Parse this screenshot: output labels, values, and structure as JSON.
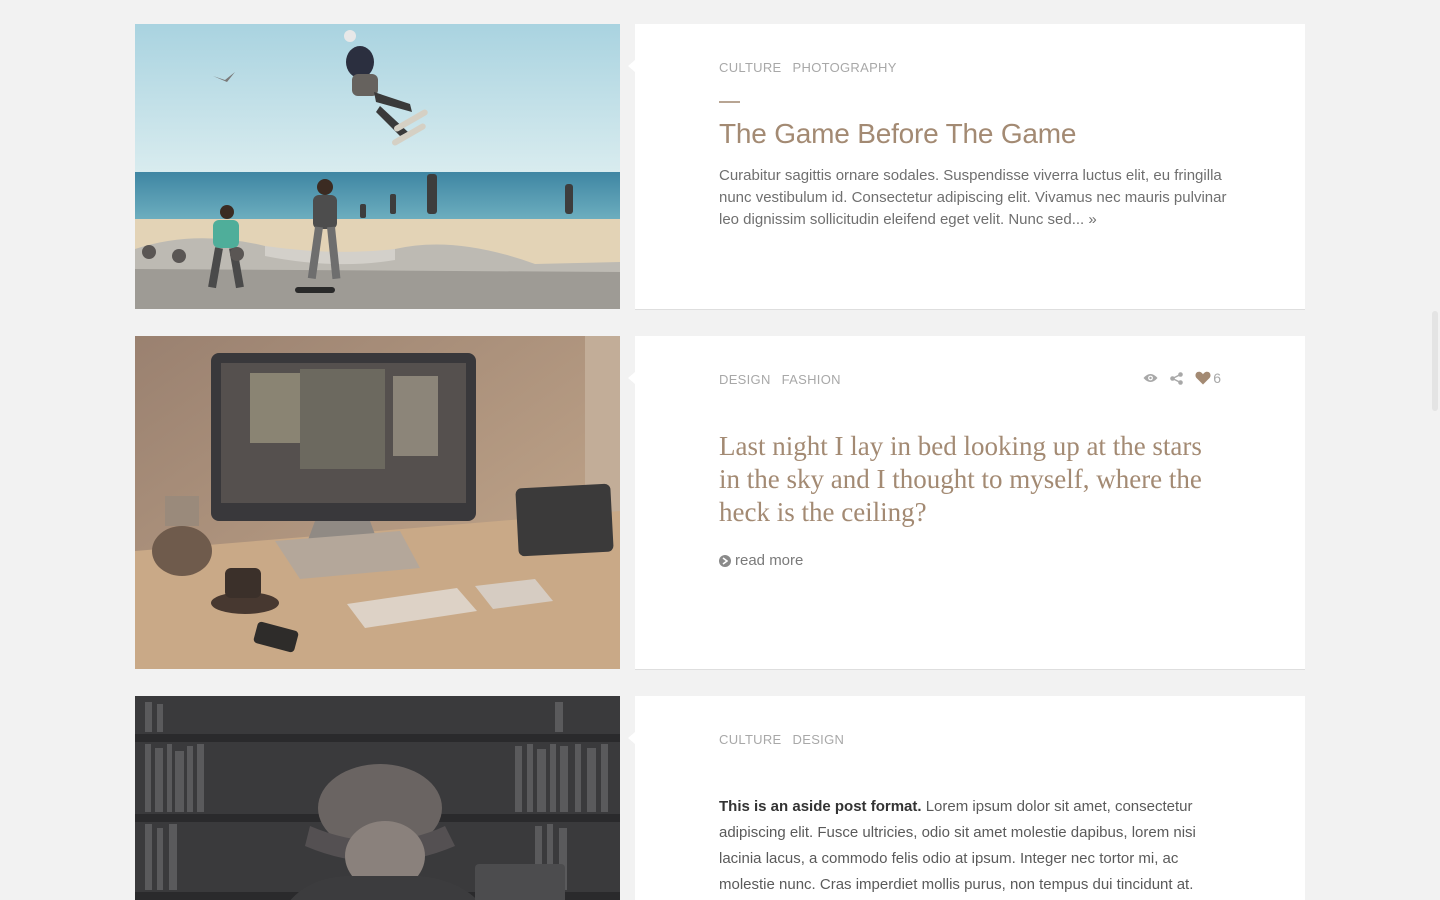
{
  "posts": [
    {
      "categories": [
        "CULTURE",
        "PHOTOGRAPHY"
      ],
      "title": "The Game Before The Game",
      "excerpt": "Curabitur sagittis ornare sodales. Suspendisse viverra luctus elit, eu fringilla nunc vestibulum id. Consectetur adipiscing elit. Vivamus nec mauris pulvinar leo dignissim sollicitudin eleifend eget velit. Nunc sed...",
      "more_link": "»",
      "image_icon": "skatepark-beach-photo"
    },
    {
      "categories": [
        "DESIGN",
        "FASHION"
      ],
      "quote": "Last night I lay in bed looking up at the stars in the sky and I thought to myself, where the heck is the ceiling?",
      "read_more": "read more",
      "likes": "6",
      "image_icon": "desk-computer-photo"
    },
    {
      "categories": [
        "CULTURE",
        "DESIGN"
      ],
      "aside_bold": "This is an aside post format.",
      "aside_text": " Lorem ipsum dolor sit amet, consectetur adipiscing elit. Fusce ultricies, odio sit amet molestie dapibus, lorem nisi lacinia lacus, a commodo felis odio at ipsum. Integer nec tortor mi, ac molestie nunc. Cras imperdiet mollis purus, non tempus dui tincidunt at.",
      "image_icon": "library-reader-photo"
    }
  ],
  "colors": {
    "accent": "#a38a73",
    "meta": "#a8a8a8",
    "body_text": "#6f6f6f",
    "background": "#f2f2f2"
  }
}
